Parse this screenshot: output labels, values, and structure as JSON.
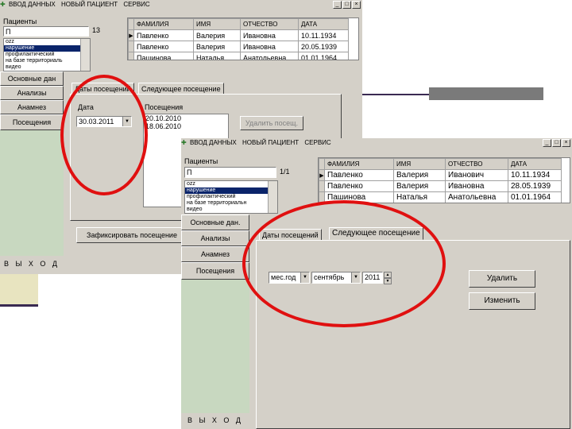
{
  "background": {
    "decoration_color": "#3a2a52",
    "deco_khaki": "#e8e4c0"
  },
  "window_back": {
    "menu": [
      "ВВОД ДАННЫХ",
      "НОВЫЙ ПАЦИЕНТ",
      "СЕРВИС"
    ],
    "patients_label": "Пациенты",
    "search_value": "П",
    "count": "13",
    "list_items": [
      "ozz",
      "нарушение",
      "профилактический",
      "на базе территориаль",
      "видео"
    ],
    "grid_headers": [
      "ФАМИЛИЯ",
      "ИМЯ",
      "ОТЧЕСТВО",
      "ДАТА"
    ],
    "grid_rows": [
      [
        "Павленко",
        "Валерия",
        "Ивановна",
        "10.11.1934"
      ],
      [
        "Павленко",
        "Валерия",
        "Ивановна",
        "20.05.1939"
      ],
      [
        "Пашинова",
        "Наталья",
        "Анатольевна",
        "01.01.1964"
      ]
    ],
    "side_buttons": [
      "Основные дан",
      "Анализы",
      "Анамнез",
      "Посещения"
    ],
    "exit_label": "В Ы Х О Д",
    "tabs": [
      "Даты посещений",
      "Следующее посещение"
    ],
    "date_label": "Дата",
    "date_value": "30.03.2011",
    "visits_label": "Посещения",
    "visits": [
      "20.10.2010",
      "18.06.2010"
    ],
    "delete_visit_label": "Удалить посещ.",
    "fix_visit_label": "Зафиксировать посещение"
  },
  "window_front": {
    "menu": [
      "ВВОД ДАННЫХ",
      "НОВЫЙ ПАЦИЕНТ",
      "СЕРВИС"
    ],
    "patients_label": "Пациенты",
    "search_value": "П",
    "count": "1/1",
    "list_items": [
      "ozz",
      "нарушение",
      "профилактический",
      "на базе территориальн",
      "видео"
    ],
    "grid_headers": [
      "ФАМИЛИЯ",
      "ИМЯ",
      "ОТЧЕСТВО",
      "ДАТА"
    ],
    "grid_rows": [
      [
        "Павленко",
        "Валерия",
        "Иванович",
        "10.11.1934"
      ],
      [
        "Павленко",
        "Валерия",
        "Ивановна",
        "28.05.1939"
      ],
      [
        "Пашинова",
        "Наталья",
        "Анатольевна",
        "01.01.1964"
      ]
    ],
    "side_buttons": [
      "Основные дан.",
      "Анализы",
      "Анамнез",
      "Посещения"
    ],
    "exit_label": "В Ы Х О Д",
    "tabs": [
      "Даты посещений",
      "Следующее посещение"
    ],
    "period_value": "мес.год",
    "month_value": "сентябрь",
    "year_value": "2011",
    "delete_label": "Удалить",
    "change_label": "Изменить"
  },
  "highlight_color": "#e01010"
}
